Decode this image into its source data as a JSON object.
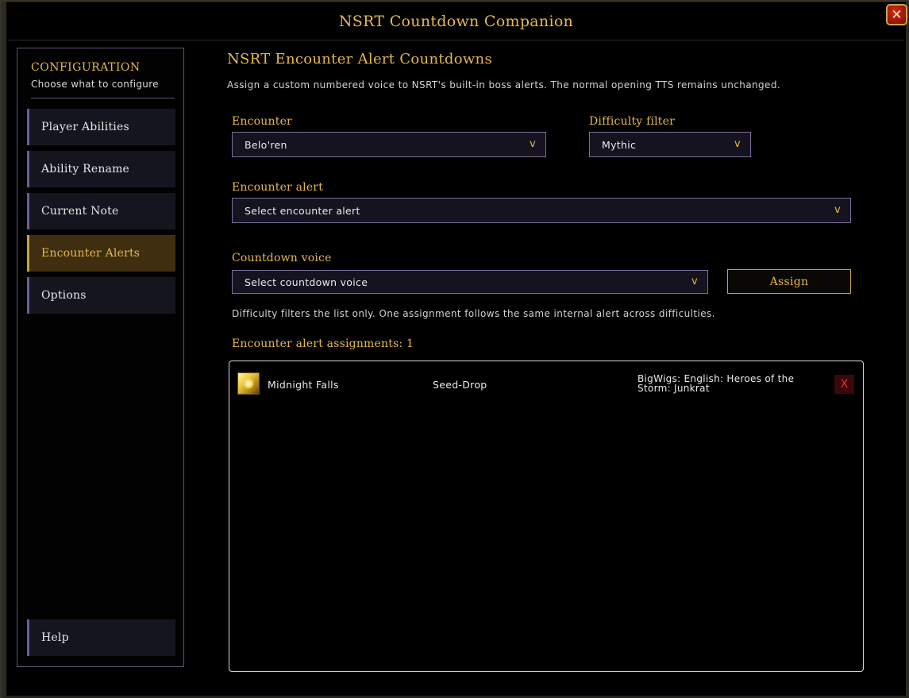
{
  "window": {
    "title": "NSRT Countdown Companion",
    "close_label": "✕"
  },
  "sidebar": {
    "title": "CONFIGURATION",
    "subtitle": "Choose what to configure",
    "items": [
      {
        "label": "Player Abilities",
        "active": false
      },
      {
        "label": "Ability Rename",
        "active": false
      },
      {
        "label": "Current Note",
        "active": false
      },
      {
        "label": "Encounter Alerts",
        "active": true
      },
      {
        "label": "Options",
        "active": false
      }
    ],
    "help_label": "Help"
  },
  "main": {
    "title": "NSRT Encounter Alert Countdowns",
    "description": "Assign a custom numbered voice to NSRT's built-in boss alerts. The normal opening TTS remains unchanged.",
    "encounter": {
      "label": "Encounter",
      "value": "Belo'ren"
    },
    "difficulty": {
      "label": "Difficulty filter",
      "value": "Mythic"
    },
    "alert": {
      "label": "Encounter alert",
      "value": "Select encounter alert"
    },
    "voice": {
      "label": "Countdown voice",
      "value": "Select countdown voice"
    },
    "chevron": "v",
    "assign_label": "Assign",
    "hint": "Difficulty filters the list only. One assignment follows the same internal alert across difficulties.",
    "assignments_label": "Encounter alert assignments: 1",
    "assignments": [
      {
        "icon": "gold-crystal-icon",
        "encounter": "Midnight Falls",
        "alert": "Seed-Drop",
        "voice_line1": "BigWigs: English: Heroes of the",
        "voice_line2": "Storm: Junkrat",
        "delete_label": "X"
      }
    ]
  },
  "colors": {
    "accent_gold": "#e6b84c",
    "active_bg": "#3f2f10",
    "nav_bar": "#6e5a98",
    "delete_red": "#e8332a"
  }
}
